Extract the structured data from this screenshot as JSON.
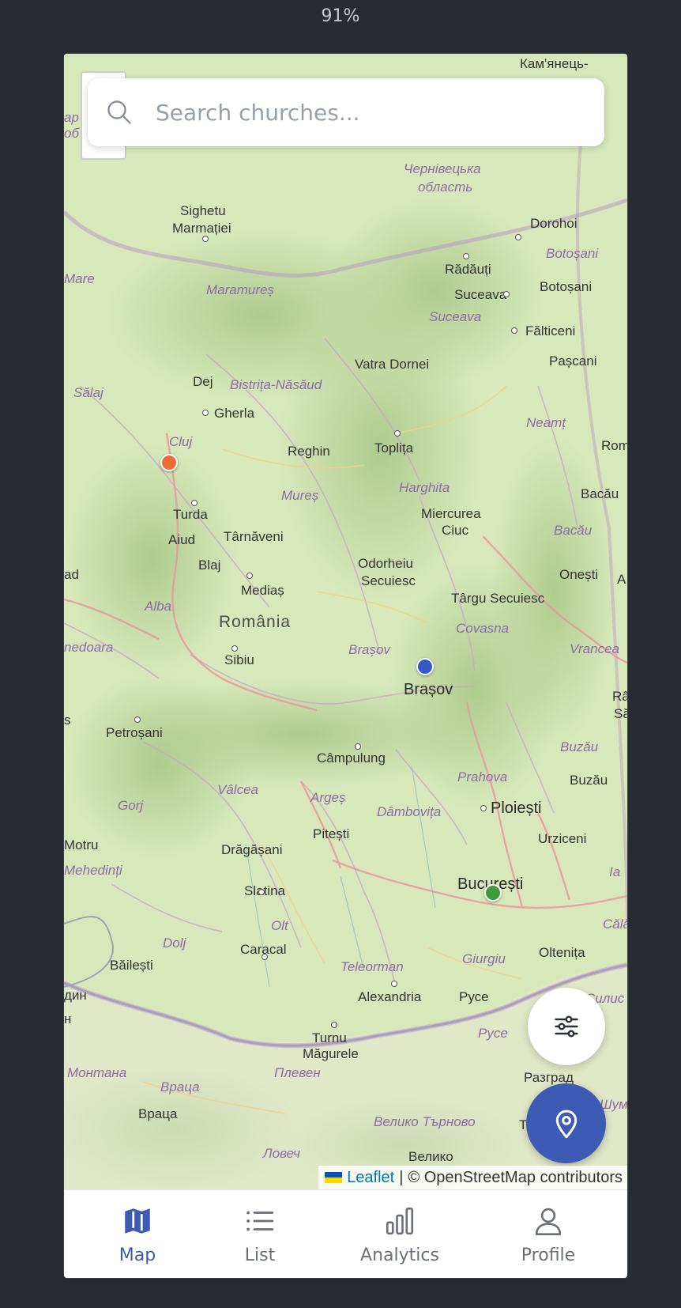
{
  "zoom_level": "91%",
  "search": {
    "placeholder": "Search churches..."
  },
  "map": {
    "country": "România",
    "cities": [
      "Кам'янець-",
      "Sighetu",
      "Marmației",
      "Dorohoi",
      "Rădăuți",
      "Botoșani",
      "Suceava",
      "Fălticeni",
      "Vatra Dornei",
      "Pașcani",
      "Dej",
      "Gherla",
      "Reghin",
      "Toplița",
      "Roman",
      "Bacău",
      "Turda",
      "Miercurea",
      "Ciuc",
      "Târnăveni",
      "Aiud",
      "Blaj",
      "Odorheiu",
      "Secuiesc",
      "Onești",
      "Mediaș",
      "Târgu Secuiesc",
      "Sibiu",
      "Brașov",
      "Râmn",
      "Săra",
      "Petroșani",
      "Câmpulung",
      "Buzău",
      "Ploiești",
      "Pitești",
      "Urziceni",
      "Motru",
      "Drăgășani",
      "București",
      "Slatina",
      "Caracal",
      "Oltenița",
      "Băilești",
      "Alexandria",
      "Русе",
      "Turnu",
      "Măgurele",
      "Разград",
      "Враца",
      "Велико",
      "Т"
    ],
    "counties": [
      "Чернівецька",
      "область",
      "Botoșani",
      "Mare",
      "Maramureș",
      "Suceava",
      "Sălaj",
      "Bistrița-Năsăud",
      "Neamț",
      "Cluj",
      "Harghita",
      "Mureș",
      "Bacău",
      "Alba",
      "Covasna",
      "nedoara",
      "Brașov",
      "Vrancea",
      "Buzău",
      "Prahova",
      "Vâlcea",
      "Argeș",
      "Gorj",
      "Dâmbovița",
      "Mehedinți",
      "Ia",
      "Olt",
      "Dolj",
      "Călă",
      "Teleorman",
      "Giurgiu",
      "Силис",
      "Русе",
      "Монтана",
      "Враца",
      "Плевен",
      "Велико Търново",
      "Ловеч",
      "Шум",
      "ad",
      "ар",
      "об",
      "дин",
      "н",
      "s",
      "A"
    ],
    "markers": [
      {
        "label": "orange",
        "color": "#ef6b35"
      },
      {
        "label": "blue",
        "color": "#3558c8"
      },
      {
        "label": "green",
        "color": "#3f9a3a"
      }
    ],
    "attribution": {
      "leaflet": "Leaflet",
      "separator": "|",
      "osm": "© OpenStreetMap contributors"
    }
  },
  "tabs": [
    {
      "label": "Map",
      "icon": "map-icon",
      "active": true
    },
    {
      "label": "List",
      "icon": "list-icon",
      "active": false
    },
    {
      "label": "Analytics",
      "icon": "bar-chart-icon",
      "active": false
    },
    {
      "label": "Profile",
      "icon": "user-icon",
      "active": false
    }
  ],
  "colors": {
    "accent": "#3d5bb5",
    "background": "#292b32",
    "map_land": "#d7e6b8"
  }
}
